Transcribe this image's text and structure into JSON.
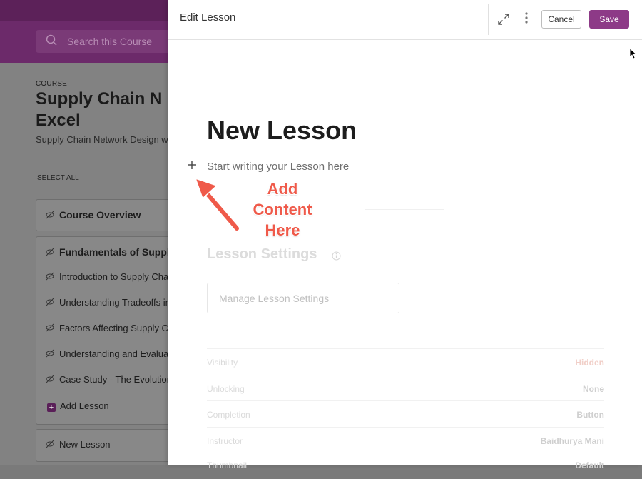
{
  "background": {
    "search_placeholder": "Search this Course",
    "course_label": "COURSE",
    "course_title": "Supply Chain Network Design with Excel",
    "course_title_line1": "Supply Chain N",
    "course_title_line2": "Excel",
    "course_subtitle": "Supply Chain Network Design wi",
    "select_all": "SELECT ALL",
    "course_overview": "Course Overview",
    "section_title": "Fundamentals of Suppl",
    "lessons": [
      "Introduction to Supply Cha",
      "Understanding Tradeoffs in",
      "Factors Affecting Supply C",
      "Understanding and Evaluat",
      "Case Study - The Evolution"
    ],
    "add_lesson": "Add Lesson",
    "new_lesson": "New Lesson"
  },
  "panel": {
    "title": "Edit Lesson",
    "cancel_label": "Cancel",
    "save_label": "Save",
    "lesson_title": "New Lesson",
    "editor_placeholder": "Start writing your Lesson here",
    "annotation_lines": [
      "Add",
      "Content",
      "Here"
    ],
    "settings_title": "Lesson Settings",
    "manage_settings_label": "Manage Lesson Settings",
    "settings": [
      {
        "key": "Visibility",
        "value": "Hidden"
      },
      {
        "key": "Unlocking",
        "value": "None"
      },
      {
        "key": "Completion",
        "value": "Button"
      },
      {
        "key": "Instructor",
        "value": "Baidhurya Mani"
      },
      {
        "key": "Thumbnail",
        "value": "Default"
      }
    ]
  },
  "colors": {
    "brand": "#8d3a87",
    "annotation": "#ef5a4a"
  },
  "icons": [
    "search-icon",
    "eye-off-icon",
    "expand-icon",
    "more-vertical-icon",
    "plus-icon",
    "info-icon",
    "arrow-icon"
  ]
}
